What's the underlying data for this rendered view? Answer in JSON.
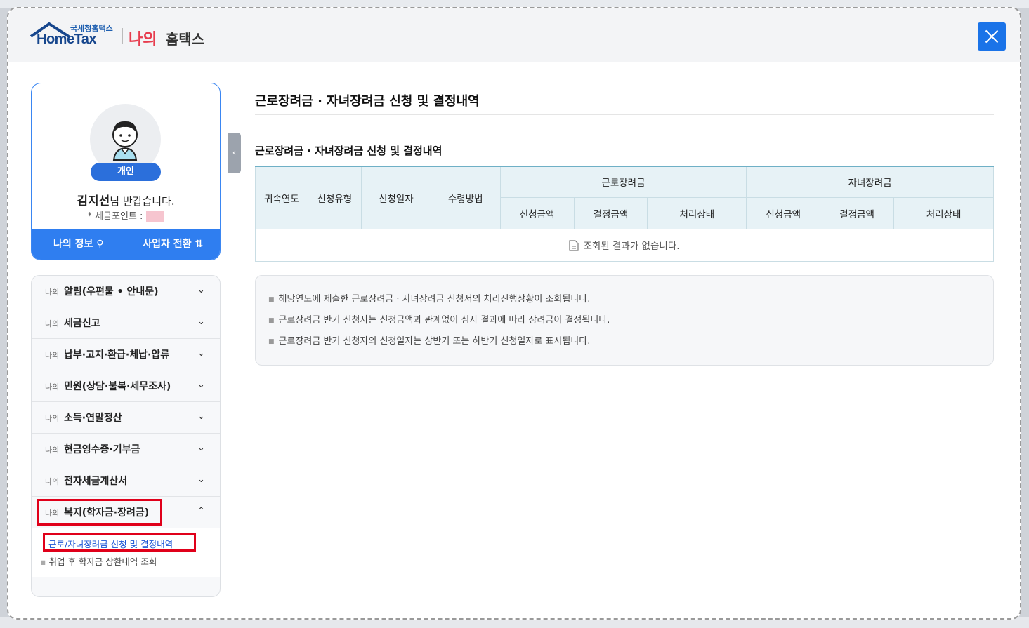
{
  "header": {
    "logo_small": "국세청홈택스",
    "logo_main": "HomeTax",
    "logo_na": "나의",
    "logo_hometax": "홈택스"
  },
  "profile": {
    "badge": "개인",
    "name": "김지선",
    "greeting_suffix": "님 반갑습니다.",
    "points_label": "* 세금포인트 :",
    "btn_my_info": "나의 정보 ⚲",
    "btn_switch": "사업자 전환 ⇅"
  },
  "menu": {
    "prefix": "나의",
    "items": [
      {
        "label": "알림(우편물 • 안내문)",
        "chev": "⌄"
      },
      {
        "label": "세금신고",
        "chev": "⌄"
      },
      {
        "label": "납부·고지·환급·체납·압류",
        "chev": "⌄"
      },
      {
        "label": "민원(상담·불복·세무조사)",
        "chev": "⌄"
      },
      {
        "label": "소득·연말정산",
        "chev": "⌄"
      },
      {
        "label": "현금영수증·기부금",
        "chev": "⌄"
      },
      {
        "label": "전자세금계산서",
        "chev": "⌄"
      },
      {
        "label": "복지(학자금·장려금)",
        "chev": "⌃"
      }
    ],
    "sub_items": [
      "근로/자녀장려금 신청 및 결정내역",
      "취업 후 학자금 상환내역 조회"
    ]
  },
  "main": {
    "page_title": "근로장려금 · 자녀장려금 신청 및 결정내역",
    "section_title": "근로장려금 · 자녀장려금 신청 및 결정내역",
    "table": {
      "cols": [
        "귀속연도",
        "신청유형",
        "신청일자",
        "수령방법"
      ],
      "group1": "근로장려금",
      "group2": "자녀장려금",
      "subcols": [
        "신청금액",
        "결정금액",
        "처리상태",
        "신청금액",
        "결정금액",
        "처리상태"
      ],
      "empty": "조회된 결과가 없습니다."
    },
    "notices": [
      "해당연도에 제출한 근로장려금 · 자녀장려금 신청서의 처리진행상황이 조회됩니다.",
      "근로장려금 반기 신청자는 신청금액과 관계없이 심사 결과에 따라 장려금이 결정됩니다.",
      "근로장려금 반기 신청자의 신청일자는 상반기 또는 하반기 신청일자로 표시됩니다."
    ]
  }
}
